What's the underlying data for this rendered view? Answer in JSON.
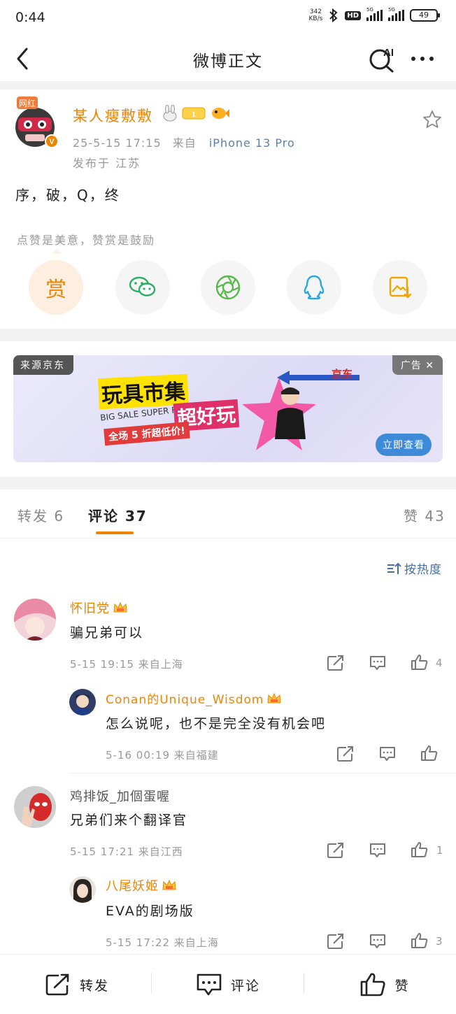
{
  "status_bar": {
    "time": "0:44",
    "net_speed_value": "342",
    "net_speed_unit": "KB/s",
    "hd_label": "HD",
    "sig1_label": "5G",
    "sig2_label": "5G",
    "battery": "49"
  },
  "nav": {
    "title": "微博正文",
    "ai_label": "AI"
  },
  "post": {
    "badge_text": "网红",
    "username": "某人瘦敷敷",
    "level": "1",
    "time": "25-5-15 17:15",
    "from_label": "来自",
    "source": "iPhone 13 Pro",
    "location": "发布于 江苏",
    "content": "序，破，Q，终",
    "reward_hint": "点赞是美意，赞赏是鼓励",
    "reward_label": "赏"
  },
  "ad": {
    "source": "来源京东",
    "tag": "广告 ✕",
    "headline1": "玩具市集",
    "headline2": "超好玩",
    "bigsale": "BIG SALE SUPER FUN",
    "discount": "全场 5 折超低价!",
    "brand": "京东",
    "cta": "立即查看"
  },
  "tabs": {
    "repost": "转发 6",
    "comment": "评论 37",
    "like": "赞 43"
  },
  "sort_label": "按热度",
  "comments": [
    {
      "name": "怀旧党",
      "text": "骗兄弟可以",
      "meta": "5-15 19:15 来自上海",
      "likes": "4",
      "replies": [
        {
          "name": "Conan的Unique_Wisdom",
          "text": "怎么说呢，也不是完全没有机会吧",
          "meta": "5-16 00:19 来自福建",
          "likes": ""
        }
      ]
    },
    {
      "name": "鸡排饭_加個蛋喔",
      "text": "兄弟们来个翻译官",
      "meta": "5-15 17:21 来自江西",
      "likes": "1",
      "replies": [
        {
          "name": "八尾妖姬",
          "text": "EVA的剧场版",
          "meta": "5-15 17:22 来自上海",
          "likes": "3"
        }
      ]
    }
  ],
  "bottom_bar": {
    "repost": "转发",
    "comment": "评论",
    "like": "赞"
  },
  "colors": {
    "accent": "#f08300",
    "link": "#5a7fb0",
    "wechat": "#2bae67",
    "moments": "#56b84a",
    "qq": "#2aa7e0",
    "save": "#f0a500"
  }
}
